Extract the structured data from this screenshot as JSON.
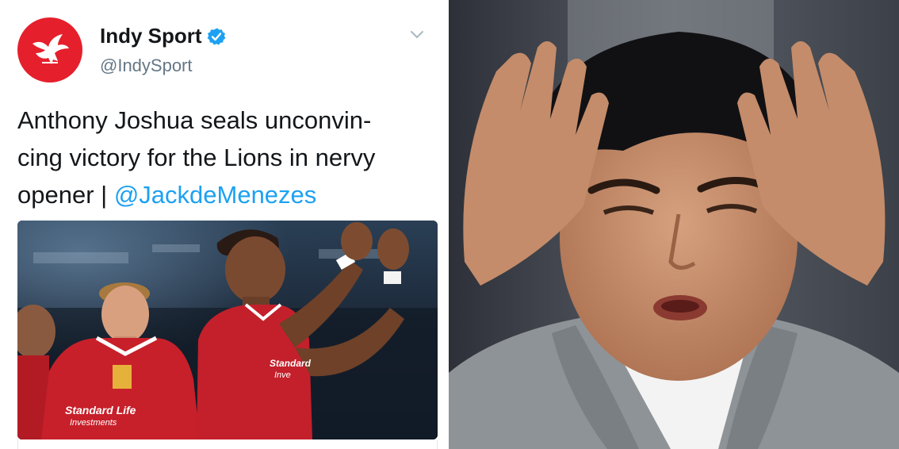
{
  "tweet": {
    "display_name": "Indy Sport",
    "handle": "@IndySport",
    "text_lines": [
      "Anthony Joshua seals unconvin-",
      "cing victory for the Lions in nervy"
    ],
    "text_line3_prefix": "opener | ",
    "mention": "@JackdeMenezes",
    "colors": {
      "avatar_bg": "#e5202c",
      "mention": "#1da1f2",
      "verified": "#1da1f2"
    },
    "icons": {
      "avatar": "eagle-logo-icon",
      "verified": "verified-badge-icon",
      "caret": "chevron-down-icon"
    },
    "media": {
      "sponsor_text_1": "Standard Life",
      "sponsor_text_2": "Investments",
      "sponsor_text_3": "Standard",
      "sponsor_text_4": "Inve"
    }
  }
}
